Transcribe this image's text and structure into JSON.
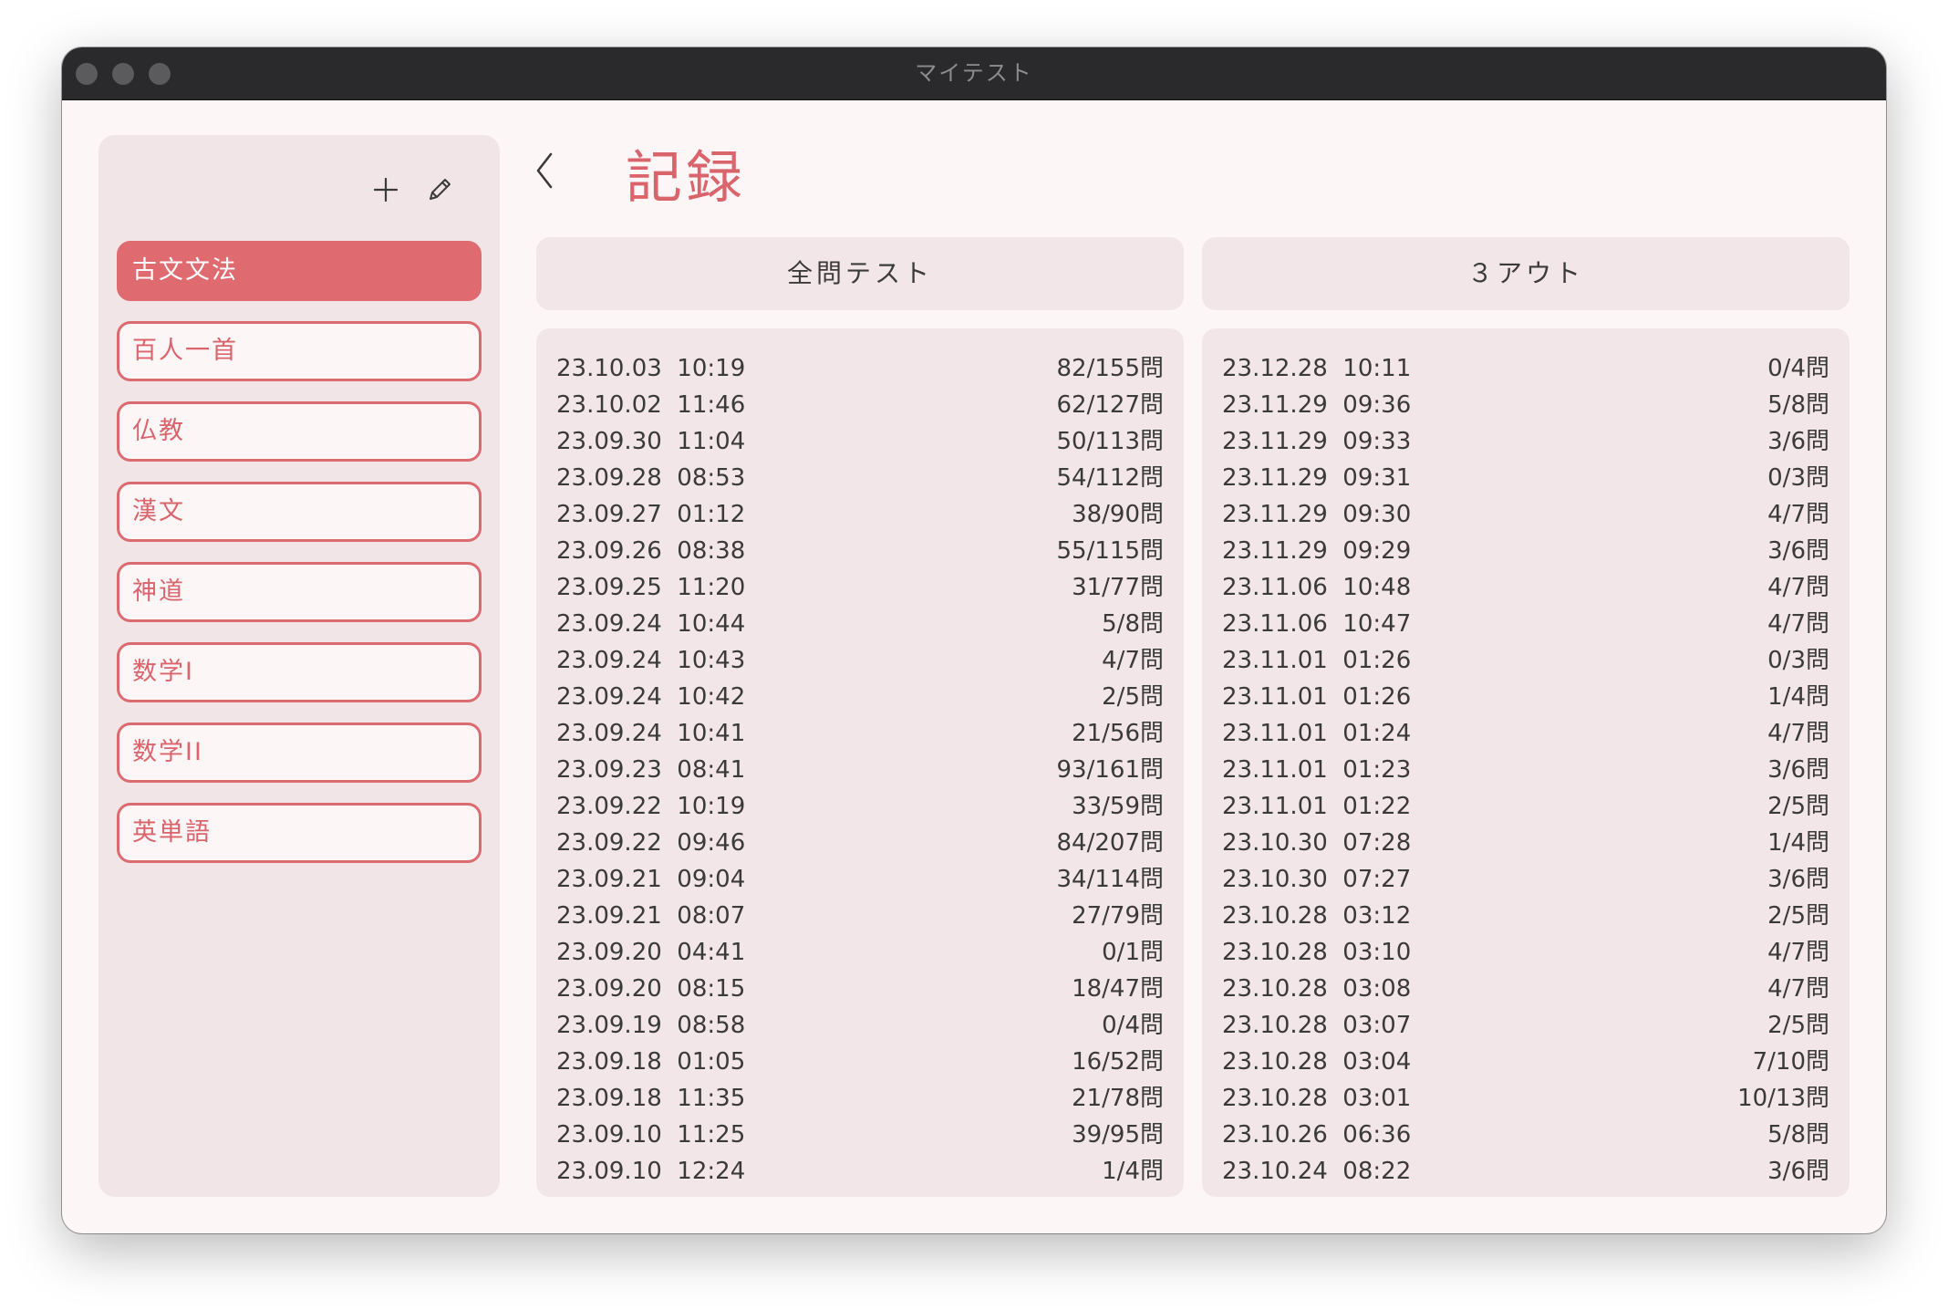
{
  "window": {
    "title": "マイテスト"
  },
  "page": {
    "title": "記録"
  },
  "sidebar": {
    "subjects": [
      "古文文法",
      "百人一首",
      "仏教",
      "漢文",
      "神道",
      "数学I",
      "数学II",
      "英単語"
    ],
    "active_index": 0
  },
  "tabs": {
    "left": "全問テスト",
    "right": "３アウト"
  },
  "records_left": [
    {
      "date": "23.10.03  10:19",
      "score": "82/155問"
    },
    {
      "date": "23.10.02  11:46",
      "score": "62/127問"
    },
    {
      "date": "23.09.30  11:04",
      "score": "50/113問"
    },
    {
      "date": "23.09.28  08:53",
      "score": "54/112問"
    },
    {
      "date": "23.09.27  01:12",
      "score": "38/90問"
    },
    {
      "date": "23.09.26  08:38",
      "score": "55/115問"
    },
    {
      "date": "23.09.25  11:20",
      "score": "31/77問"
    },
    {
      "date": "23.09.24  10:44",
      "score": "5/8問"
    },
    {
      "date": "23.09.24  10:43",
      "score": "4/7問"
    },
    {
      "date": "23.09.24  10:42",
      "score": "2/5問"
    },
    {
      "date": "23.09.24  10:41",
      "score": "21/56問"
    },
    {
      "date": "23.09.23  08:41",
      "score": "93/161問"
    },
    {
      "date": "23.09.22  10:19",
      "score": "33/59問"
    },
    {
      "date": "23.09.22  09:46",
      "score": "84/207問"
    },
    {
      "date": "23.09.21  09:04",
      "score": "34/114問"
    },
    {
      "date": "23.09.21  08:07",
      "score": "27/79問"
    },
    {
      "date": "23.09.20  04:41",
      "score": "0/1問"
    },
    {
      "date": "23.09.20  08:15",
      "score": "18/47問"
    },
    {
      "date": "23.09.19  08:58",
      "score": "0/4問"
    },
    {
      "date": "23.09.18  01:05",
      "score": "16/52問"
    },
    {
      "date": "23.09.18  11:35",
      "score": "21/78問"
    },
    {
      "date": "23.09.10  11:25",
      "score": "39/95問"
    },
    {
      "date": "23.09.10  12:24",
      "score": "1/4問"
    }
  ],
  "records_right": [
    {
      "date": "23.12.28  10:11",
      "score": "0/4問"
    },
    {
      "date": "23.11.29  09:36",
      "score": "5/8問"
    },
    {
      "date": "23.11.29  09:33",
      "score": "3/6問"
    },
    {
      "date": "23.11.29  09:31",
      "score": "0/3問"
    },
    {
      "date": "23.11.29  09:30",
      "score": "4/7問"
    },
    {
      "date": "23.11.29  09:29",
      "score": "3/6問"
    },
    {
      "date": "23.11.06  10:48",
      "score": "4/7問"
    },
    {
      "date": "23.11.06  10:47",
      "score": "4/7問"
    },
    {
      "date": "23.11.01  01:26",
      "score": "0/3問"
    },
    {
      "date": "23.11.01  01:26",
      "score": "1/4問"
    },
    {
      "date": "23.11.01  01:24",
      "score": "4/7問"
    },
    {
      "date": "23.11.01  01:23",
      "score": "3/6問"
    },
    {
      "date": "23.11.01  01:22",
      "score": "2/5問"
    },
    {
      "date": "23.10.30  07:28",
      "score": "1/4問"
    },
    {
      "date": "23.10.30  07:27",
      "score": "3/6問"
    },
    {
      "date": "23.10.28  03:12",
      "score": "2/5問"
    },
    {
      "date": "23.10.28  03:10",
      "score": "4/7問"
    },
    {
      "date": "23.10.28  03:08",
      "score": "4/7問"
    },
    {
      "date": "23.10.28  03:07",
      "score": "2/5問"
    },
    {
      "date": "23.10.28  03:04",
      "score": "7/10問"
    },
    {
      "date": "23.10.28  03:01",
      "score": "10/13問"
    },
    {
      "date": "23.10.26  06:36",
      "score": "5/8問"
    },
    {
      "date": "23.10.24  08:22",
      "score": "3/6問"
    }
  ],
  "icons": {
    "add": "plus-icon",
    "edit": "pencil-icon",
    "back": "chevron-left-icon"
  },
  "colors": {
    "accent": "#df6b71",
    "titlebar": "#2a2a2c",
    "panel": "#f3e6e8",
    "background": "#fcf6f7"
  }
}
